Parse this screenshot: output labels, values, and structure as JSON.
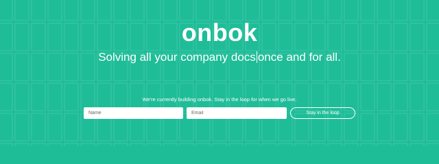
{
  "brand": {
    "logo_text": "onbok"
  },
  "hero": {
    "tagline_before": "Solving all your company docs",
    "tagline_after": "once and for all."
  },
  "signup": {
    "notice": "We're currently building onbok. Stay in the loop for when we go live.",
    "name_placeholder": "Name",
    "email_placeholder": "Email",
    "submit_label": "Stay in the loop"
  },
  "colors": {
    "background": "#1fbc98",
    "pattern_line": "#3cc8a7",
    "text": "#ffffff",
    "field_background": "#ffffff"
  }
}
